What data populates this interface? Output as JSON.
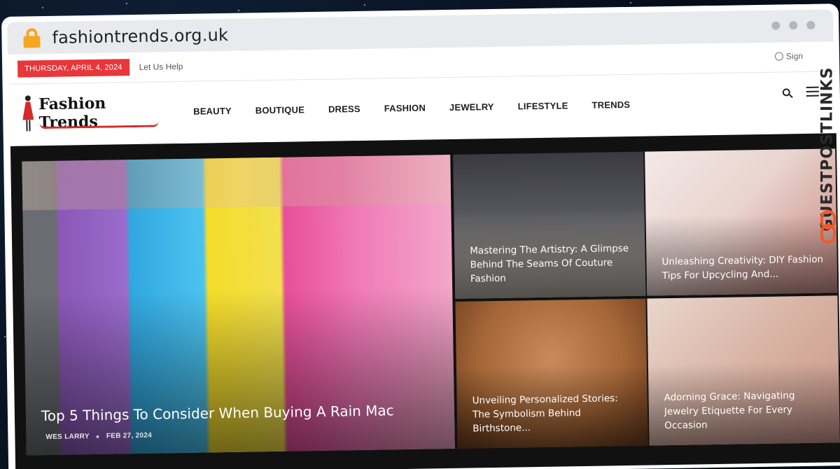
{
  "browser": {
    "domain": "fashiontrends.org.uk"
  },
  "topbar": {
    "date": "THURSDAY, APRIL 4, 2024",
    "help_link": "Let Us Help",
    "signin": "Sign"
  },
  "logo": {
    "text": "Fashion Trends"
  },
  "nav": [
    "BEAUTY",
    "BOUTIQUE",
    "DRESS",
    "FASHION",
    "JEWELRY",
    "LIFESTYLE",
    "TRENDS"
  ],
  "featured": {
    "title": "Top 5 Things To Consider When Buying A Rain Mac",
    "author": "WES LARRY",
    "date": "FEB 27, 2024"
  },
  "posts": [
    {
      "title": "Mastering The Artistry: A Glimpse Behind The Seams Of Couture Fashion"
    },
    {
      "title": "Unleashing Creativity: DIY Fashion Tips For Upcycling And..."
    },
    {
      "title": "Unveiling Personalized Stories: The Symbolism Behind Birthstone..."
    },
    {
      "title": "Adorning Grace: Navigating Jewelry Etiquette For Every Occasion"
    }
  ],
  "watermark": {
    "text": "GUESTPOSTLINKS"
  },
  "colors": {
    "accent": "#e8363a",
    "watermark_orange": "#f05a28",
    "lock": "#f5a623"
  }
}
